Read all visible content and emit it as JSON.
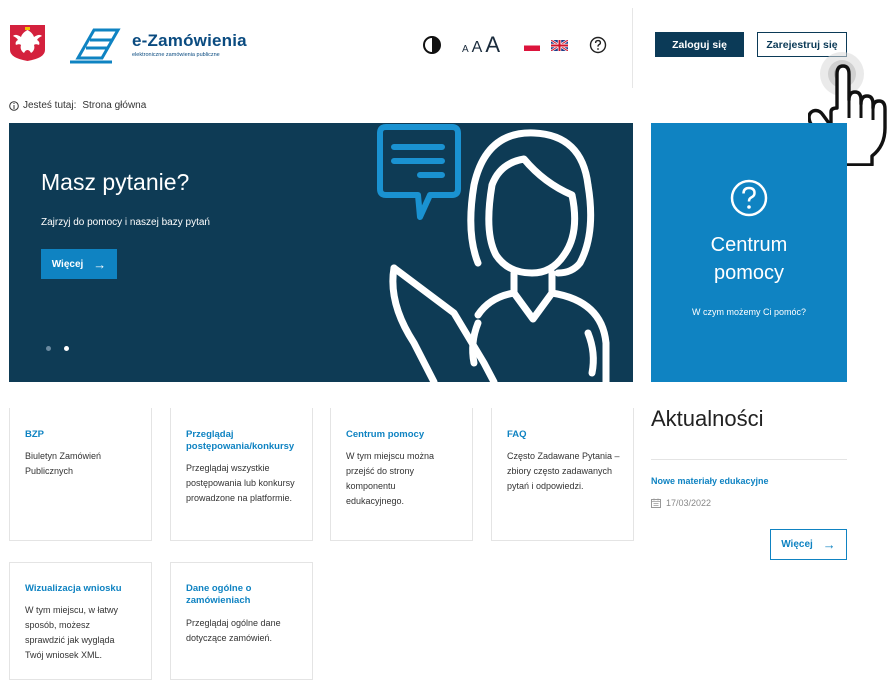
{
  "header": {
    "logo_title": "e-Zamówienia",
    "logo_subtitle": "elektroniczne zamówienia publiczne",
    "font_size_small": "A",
    "font_size_medium": "A",
    "font_size_large": "A",
    "login_label": "Zaloguj się",
    "register_label": "Zarejestruj się"
  },
  "breadcrumb": {
    "prefix": "Jesteś tutaj:",
    "current": "Strona główna"
  },
  "hero": {
    "title": "Masz pytanie?",
    "subtitle": "Zajrzyj do pomocy i naszej bazy pytań",
    "button_label": "Więcej",
    "button_arrow": "→"
  },
  "help_center": {
    "title_line1": "Centrum",
    "title_line2": "pomocy",
    "subtitle": "W czym możemy Ci pomóc?"
  },
  "cards": [
    {
      "title": "BZP",
      "description": "Biuletyn Zamówień Publicznych"
    },
    {
      "title": "Przeglądaj postępowania/konkursy",
      "description": "Przeglądaj wszystkie postępowania lub konkursy prowadzone na platformie."
    },
    {
      "title": "Centrum pomocy",
      "description": "W tym miejscu można przejść do strony komponentu edukacyjnego."
    },
    {
      "title": "FAQ",
      "description": "Często Zadawane Pytania – zbiory często zadawanych pytań i odpowiedzi."
    },
    {
      "title": "Wizualizacja wniosku",
      "description": "W tym miejscu, w łatwy sposób, możesz sprawdzić jak wygląda Twój wniosek XML."
    },
    {
      "title": "Dane ogólne o zamówieniach",
      "description": "Przeglądaj ogólne dane dotyczące zamówień."
    }
  ],
  "news": {
    "title": "Aktualności",
    "item_title": "Nowe materiały edukacyjne",
    "item_date": "17/03/2022",
    "button_label": "Więcej",
    "button_arrow": "→"
  },
  "colors": {
    "navy": "#0e3b55",
    "accent_blue": "#0f83c2",
    "login_bg": "#0b3a57"
  },
  "icons": [
    "poland-emblem-icon",
    "e-zamowienia-logo-icon",
    "contrast-icon",
    "polish-flag-icon",
    "uk-flag-icon",
    "help-icon",
    "info-icon",
    "chat-bubble-icon",
    "woman-illustration-icon",
    "pointing-hand-icon",
    "calendar-icon"
  ]
}
